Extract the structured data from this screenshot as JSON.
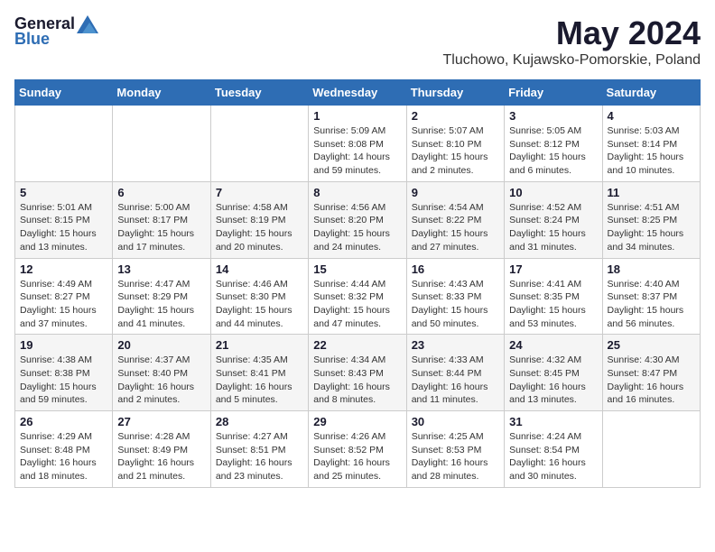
{
  "header": {
    "logo_general": "General",
    "logo_blue": "Blue",
    "month_year": "May 2024",
    "location": "Tluchowo, Kujawsko-Pomorskie, Poland"
  },
  "days_of_week": [
    "Sunday",
    "Monday",
    "Tuesday",
    "Wednesday",
    "Thursday",
    "Friday",
    "Saturday"
  ],
  "weeks": [
    [
      {
        "day": "",
        "info": ""
      },
      {
        "day": "",
        "info": ""
      },
      {
        "day": "",
        "info": ""
      },
      {
        "day": "1",
        "info": "Sunrise: 5:09 AM\nSunset: 8:08 PM\nDaylight: 14 hours and 59 minutes."
      },
      {
        "day": "2",
        "info": "Sunrise: 5:07 AM\nSunset: 8:10 PM\nDaylight: 15 hours and 2 minutes."
      },
      {
        "day": "3",
        "info": "Sunrise: 5:05 AM\nSunset: 8:12 PM\nDaylight: 15 hours and 6 minutes."
      },
      {
        "day": "4",
        "info": "Sunrise: 5:03 AM\nSunset: 8:14 PM\nDaylight: 15 hours and 10 minutes."
      }
    ],
    [
      {
        "day": "5",
        "info": "Sunrise: 5:01 AM\nSunset: 8:15 PM\nDaylight: 15 hours and 13 minutes."
      },
      {
        "day": "6",
        "info": "Sunrise: 5:00 AM\nSunset: 8:17 PM\nDaylight: 15 hours and 17 minutes."
      },
      {
        "day": "7",
        "info": "Sunrise: 4:58 AM\nSunset: 8:19 PM\nDaylight: 15 hours and 20 minutes."
      },
      {
        "day": "8",
        "info": "Sunrise: 4:56 AM\nSunset: 8:20 PM\nDaylight: 15 hours and 24 minutes."
      },
      {
        "day": "9",
        "info": "Sunrise: 4:54 AM\nSunset: 8:22 PM\nDaylight: 15 hours and 27 minutes."
      },
      {
        "day": "10",
        "info": "Sunrise: 4:52 AM\nSunset: 8:24 PM\nDaylight: 15 hours and 31 minutes."
      },
      {
        "day": "11",
        "info": "Sunrise: 4:51 AM\nSunset: 8:25 PM\nDaylight: 15 hours and 34 minutes."
      }
    ],
    [
      {
        "day": "12",
        "info": "Sunrise: 4:49 AM\nSunset: 8:27 PM\nDaylight: 15 hours and 37 minutes."
      },
      {
        "day": "13",
        "info": "Sunrise: 4:47 AM\nSunset: 8:29 PM\nDaylight: 15 hours and 41 minutes."
      },
      {
        "day": "14",
        "info": "Sunrise: 4:46 AM\nSunset: 8:30 PM\nDaylight: 15 hours and 44 minutes."
      },
      {
        "day": "15",
        "info": "Sunrise: 4:44 AM\nSunset: 8:32 PM\nDaylight: 15 hours and 47 minutes."
      },
      {
        "day": "16",
        "info": "Sunrise: 4:43 AM\nSunset: 8:33 PM\nDaylight: 15 hours and 50 minutes."
      },
      {
        "day": "17",
        "info": "Sunrise: 4:41 AM\nSunset: 8:35 PM\nDaylight: 15 hours and 53 minutes."
      },
      {
        "day": "18",
        "info": "Sunrise: 4:40 AM\nSunset: 8:37 PM\nDaylight: 15 hours and 56 minutes."
      }
    ],
    [
      {
        "day": "19",
        "info": "Sunrise: 4:38 AM\nSunset: 8:38 PM\nDaylight: 15 hours and 59 minutes."
      },
      {
        "day": "20",
        "info": "Sunrise: 4:37 AM\nSunset: 8:40 PM\nDaylight: 16 hours and 2 minutes."
      },
      {
        "day": "21",
        "info": "Sunrise: 4:35 AM\nSunset: 8:41 PM\nDaylight: 16 hours and 5 minutes."
      },
      {
        "day": "22",
        "info": "Sunrise: 4:34 AM\nSunset: 8:43 PM\nDaylight: 16 hours and 8 minutes."
      },
      {
        "day": "23",
        "info": "Sunrise: 4:33 AM\nSunset: 8:44 PM\nDaylight: 16 hours and 11 minutes."
      },
      {
        "day": "24",
        "info": "Sunrise: 4:32 AM\nSunset: 8:45 PM\nDaylight: 16 hours and 13 minutes."
      },
      {
        "day": "25",
        "info": "Sunrise: 4:30 AM\nSunset: 8:47 PM\nDaylight: 16 hours and 16 minutes."
      }
    ],
    [
      {
        "day": "26",
        "info": "Sunrise: 4:29 AM\nSunset: 8:48 PM\nDaylight: 16 hours and 18 minutes."
      },
      {
        "day": "27",
        "info": "Sunrise: 4:28 AM\nSunset: 8:49 PM\nDaylight: 16 hours and 21 minutes."
      },
      {
        "day": "28",
        "info": "Sunrise: 4:27 AM\nSunset: 8:51 PM\nDaylight: 16 hours and 23 minutes."
      },
      {
        "day": "29",
        "info": "Sunrise: 4:26 AM\nSunset: 8:52 PM\nDaylight: 16 hours and 25 minutes."
      },
      {
        "day": "30",
        "info": "Sunrise: 4:25 AM\nSunset: 8:53 PM\nDaylight: 16 hours and 28 minutes."
      },
      {
        "day": "31",
        "info": "Sunrise: 4:24 AM\nSunset: 8:54 PM\nDaylight: 16 hours and 30 minutes."
      },
      {
        "day": "",
        "info": ""
      }
    ]
  ]
}
